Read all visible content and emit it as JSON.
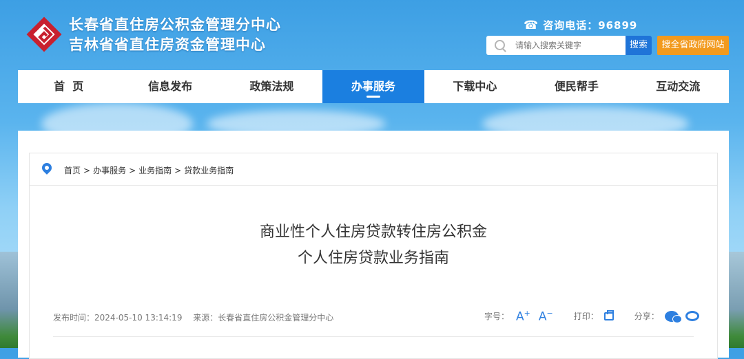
{
  "header": {
    "title_line1": "长春省直住房公积金管理分中心",
    "title_line2": "吉林省省直住房资金管理中心",
    "hotline": "咨询电话：96899",
    "search_placeholder": "请输入搜索关键字",
    "search_button": "搜索",
    "province_button": "搜全省政府网站"
  },
  "nav": {
    "items": [
      {
        "label": "首  页"
      },
      {
        "label": "信息发布"
      },
      {
        "label": "政策法规"
      },
      {
        "label": "办事服务"
      },
      {
        "label": "下载中心"
      },
      {
        "label": "便民帮手"
      },
      {
        "label": "互动交流"
      }
    ],
    "active_index": 3
  },
  "breadcrumb": [
    "首页",
    "办事服务",
    "业务指南",
    "贷款业务指南"
  ],
  "article": {
    "title_line1": "商业性个人住房贷款转住房公积金",
    "title_line2": "个人住房贷款业务指南",
    "publish_time": "发布时间：2024-05-10 13:14:19",
    "source": "来源：长春省直住房公积金管理分中心",
    "font_size_label": "字号：",
    "font_larger": "A",
    "font_smaller": "A",
    "print_label": "打印：",
    "share_label": "分享："
  },
  "colors": {
    "primary": "#1b7fe0",
    "accent_orange": "#f29a1e",
    "logo_red": "#c8202f"
  }
}
